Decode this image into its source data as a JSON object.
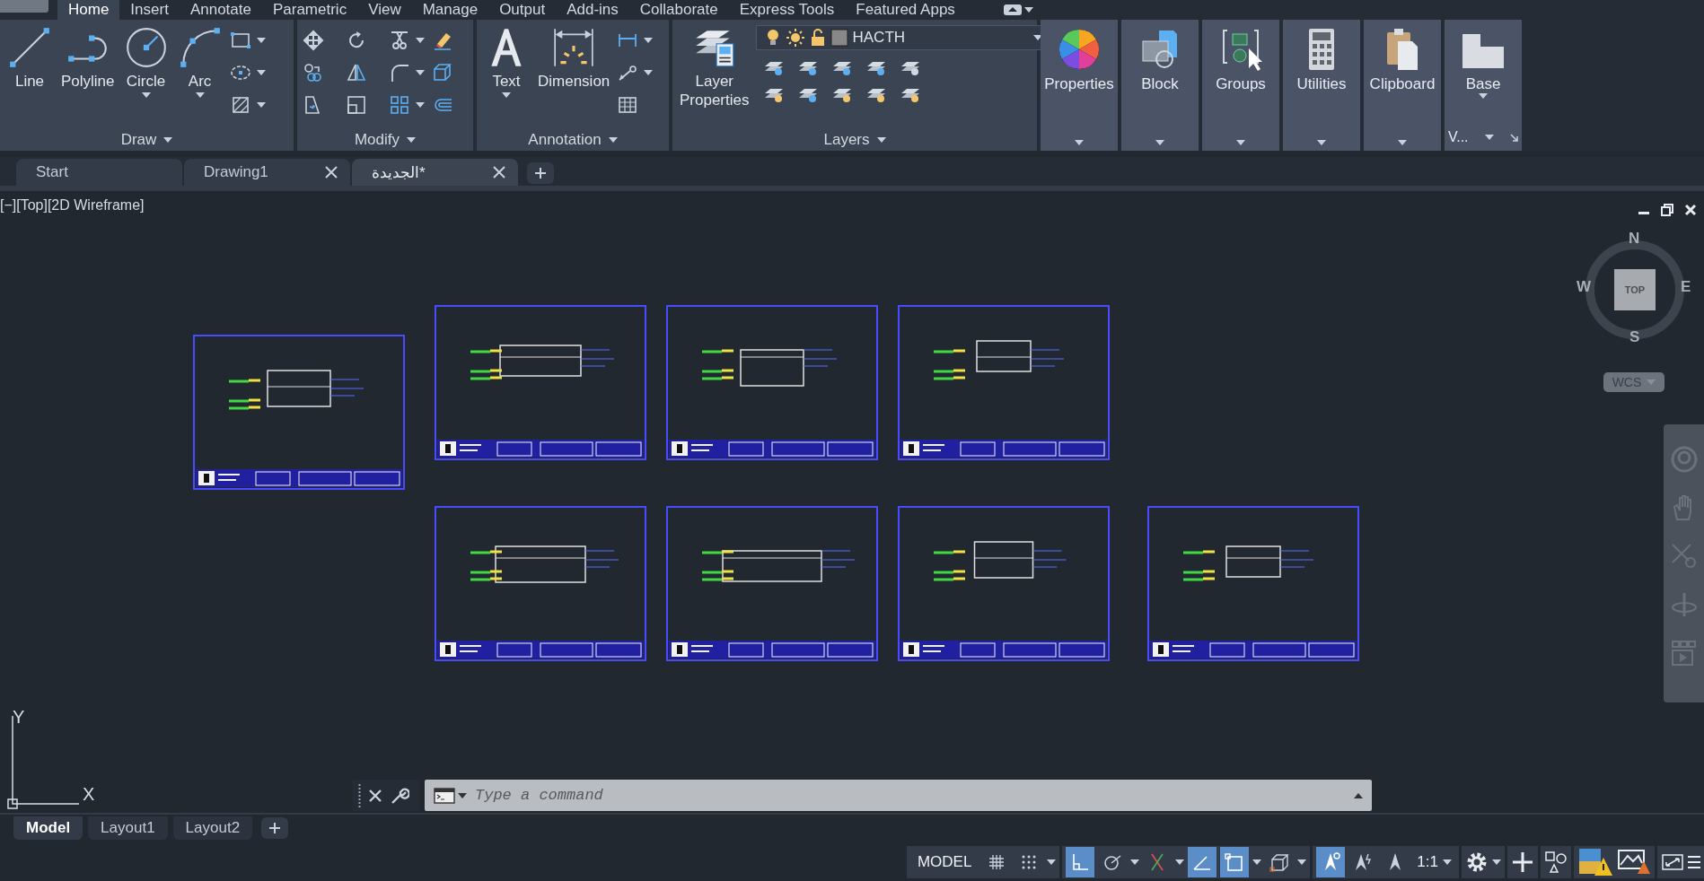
{
  "menu_tabs": [
    {
      "label": "Home",
      "selected": true
    },
    {
      "label": "Insert",
      "selected": false
    },
    {
      "label": "Annotate",
      "selected": false
    },
    {
      "label": "Parametric",
      "selected": false
    },
    {
      "label": "View",
      "selected": false
    },
    {
      "label": "Manage",
      "selected": false
    },
    {
      "label": "Output",
      "selected": false
    },
    {
      "label": "Add-ins",
      "selected": false
    },
    {
      "label": "Collaborate",
      "selected": false
    },
    {
      "label": "Express Tools",
      "selected": false
    },
    {
      "label": "Featured Apps",
      "selected": false
    }
  ],
  "ribbon": {
    "panels": [
      {
        "title": "Draw",
        "big_tools": [
          {
            "label": "Line",
            "dropdown": false
          },
          {
            "label": "Polyline",
            "dropdown": false
          },
          {
            "label": "Circle",
            "dropdown": true
          },
          {
            "label": "Arc",
            "dropdown": true
          }
        ]
      },
      {
        "title": "Modify"
      },
      {
        "title": "Annotation",
        "big_tools": [
          {
            "label": "Text",
            "dropdown": true
          },
          {
            "label": "Dimension",
            "dropdown": false
          }
        ]
      },
      {
        "title": "Layers",
        "big_tools": [
          {
            "label": "Layer Properties",
            "dropdown": false
          }
        ],
        "current_layer": "HACTH"
      }
    ],
    "collapsed_panels": [
      {
        "label": "Properties"
      },
      {
        "label": "Block"
      },
      {
        "label": "Groups"
      },
      {
        "label": "Utilities"
      },
      {
        "label": "Clipboard"
      },
      {
        "label": "Base",
        "sublabel": "V..."
      }
    ]
  },
  "file_tabs": [
    {
      "label": "Start",
      "closable": false,
      "selected": false
    },
    {
      "label": "Drawing1",
      "closable": true,
      "selected": false
    },
    {
      "label": "الجديدة*",
      "closable": true,
      "selected": true
    }
  ],
  "viewport": {
    "label": "[−][Top][2D Wireframe]",
    "viewcube": {
      "north": "N",
      "south": "S",
      "east": "E",
      "west": "W",
      "face": "TOP"
    },
    "coordinate_system": "WCS",
    "ucs": {
      "x": "X",
      "y": "Y"
    }
  },
  "command_line": {
    "placeholder": "Type a command"
  },
  "layout_tabs": [
    {
      "label": "Model",
      "selected": true
    },
    {
      "label": "Layout1",
      "selected": false
    },
    {
      "label": "Layout2",
      "selected": false
    }
  ],
  "status_bar": {
    "mode": "MODEL",
    "scale": "1:1",
    "toggles": [
      {
        "on": false
      },
      {
        "on": false
      },
      {
        "on": true
      },
      {
        "on": false
      },
      {
        "on": false
      },
      {
        "on": true
      },
      {
        "on": true
      },
      {
        "on": false
      },
      {
        "on": true
      },
      {
        "on": false
      },
      {
        "on": false
      }
    ]
  }
}
